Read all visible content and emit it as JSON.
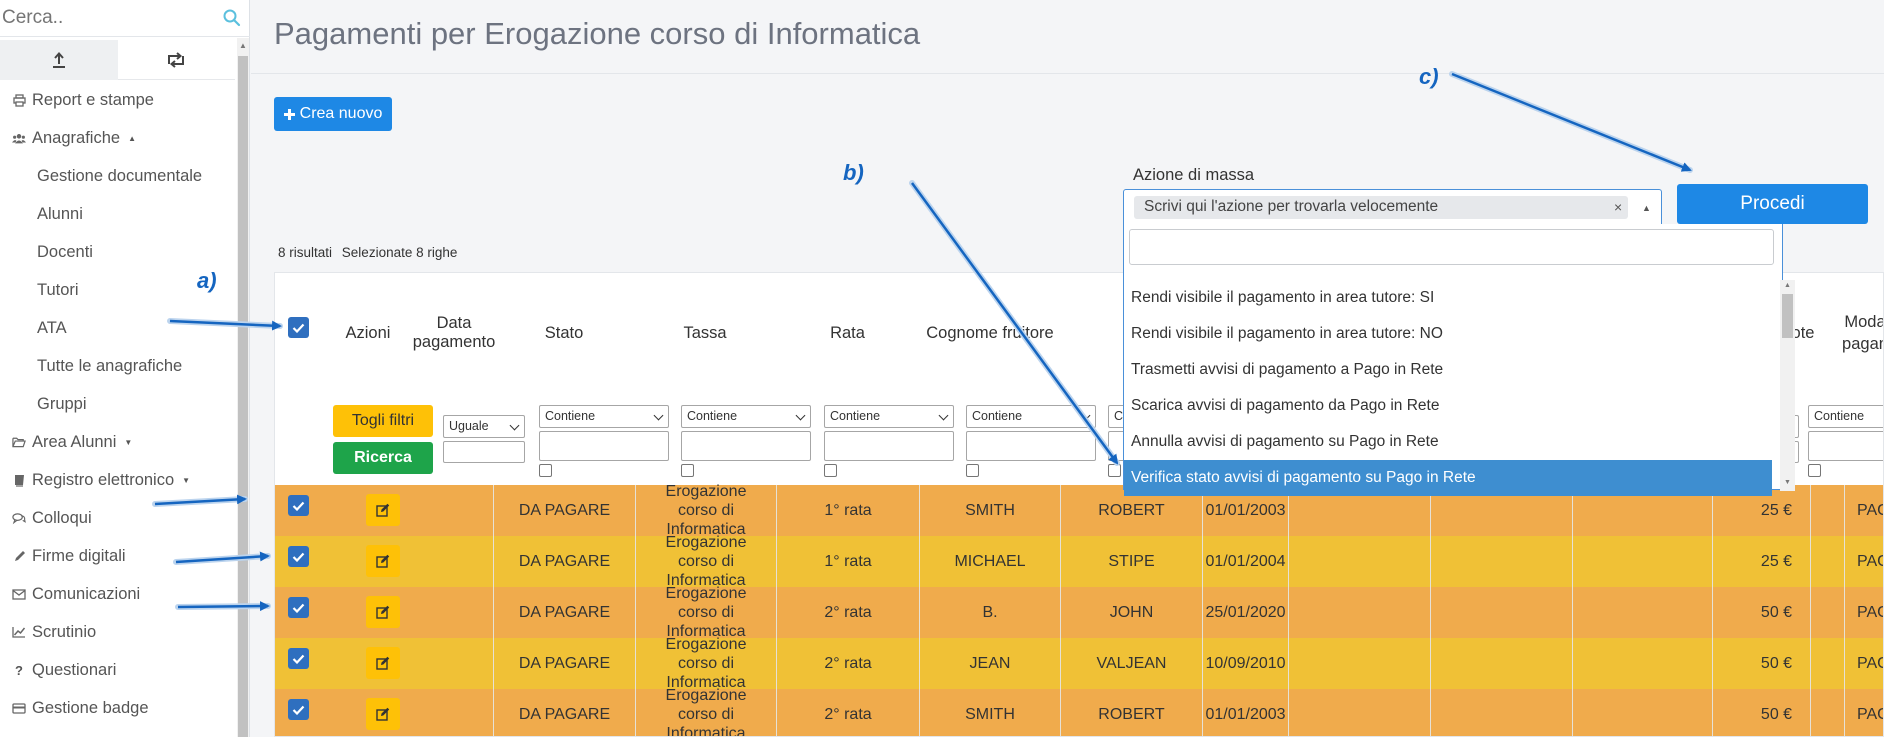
{
  "sidebar": {
    "search_placeholder": "Cerca..",
    "menu": [
      {
        "label": "Report e stampe",
        "icon": "print-icon",
        "level": 0
      },
      {
        "label": "Anagrafiche",
        "icon": "users-icon",
        "level": 0,
        "caret": "▲"
      },
      {
        "label": "Gestione documentale",
        "level": 1
      },
      {
        "label": "Alunni",
        "level": 1
      },
      {
        "label": "Docenti",
        "level": 1
      },
      {
        "label": "Tutori",
        "level": 1
      },
      {
        "label": "ATA",
        "level": 1
      },
      {
        "label": "Tutte le anagrafiche",
        "level": 1
      },
      {
        "label": "Gruppi",
        "level": 1
      },
      {
        "label": "Area Alunni",
        "icon": "folder-open-icon",
        "level": 0,
        "caret": "▼"
      },
      {
        "label": "Registro elettronico",
        "icon": "book-icon",
        "level": 0,
        "caret": "▼"
      },
      {
        "label": "Colloqui",
        "icon": "comments-icon",
        "level": 0
      },
      {
        "label": "Firme digitali",
        "icon": "pencil-icon",
        "level": 0
      },
      {
        "label": "Comunicazioni",
        "icon": "envelope-icon",
        "level": 0
      },
      {
        "label": "Scrutinio",
        "icon": "line-chart-icon",
        "level": 0
      },
      {
        "label": "Questionari",
        "icon": "question-icon",
        "level": 0
      },
      {
        "label": "Gestione badge",
        "icon": "credit-card-icon",
        "level": 0
      }
    ]
  },
  "page": {
    "title": "Pagamenti per Erogazione corso di Informatica",
    "create_button": "Crea nuovo",
    "mass_action_label": "Azione di massa",
    "mass_action_placeholder": "Scrivi qui l'azione per trovarla velocemente",
    "clear_symbol": "×",
    "procedi_button": "Procedi",
    "results_count": "8 risultati",
    "selected_count": "Selezionate 8 righe"
  },
  "dropdown": {
    "options": [
      "Rendi visibile il pagamento in area tutore: SI",
      "Rendi visibile il pagamento in area tutore: NO",
      "Trasmetti avvisi di pagamento a Pago in Rete",
      "Scarica avvisi di pagamento da Pago in Rete",
      "Annulla avvisi di pagamento su Pago in Rete",
      "Verifica stato avvisi di pagamento su Pago in Rete"
    ],
    "highlighted_index": 5
  },
  "table": {
    "headers": {
      "azioni": "Azioni",
      "data_pagamento": "Data pagamento",
      "stato": "Stato",
      "tassa": "Tassa",
      "rata": "Rata",
      "cognome": "Cognome fruitore",
      "note_partial": "ote",
      "modalita_partial": "Moda pagan"
    },
    "filters": {
      "togli_filtri": "Togli filtri",
      "ricerca": "Ricerca",
      "uguale": "Uguale",
      "contiene": "Contiene",
      "partial_c": "C"
    },
    "rows": [
      {
        "stato": "DA PAGARE",
        "tassa": "Erogazione corso di Informatica",
        "rata": "1° rata",
        "cognome": "SMITH",
        "nome": "ROBERT",
        "data": "01/01/2003",
        "importo": "25 €",
        "modalita": "PAGO"
      },
      {
        "stato": "DA PAGARE",
        "tassa": "Erogazione corso di Informatica",
        "rata": "1° rata",
        "cognome": "MICHAEL",
        "nome": "STIPE",
        "data": "01/01/2004",
        "importo": "25 €",
        "modalita": "PAGO"
      },
      {
        "stato": "DA PAGARE",
        "tassa": "Erogazione corso di Informatica",
        "rata": "2° rata",
        "cognome": "B.",
        "nome": "JOHN",
        "data": "25/01/2020",
        "importo": "50 €",
        "modalita": "PAGO"
      },
      {
        "stato": "DA PAGARE",
        "tassa": "Erogazione corso di Informatica",
        "rata": "2° rata",
        "cognome": "JEAN",
        "nome": "VALJEAN",
        "data": "10/09/2010",
        "importo": "50 €",
        "modalita": "PAGO"
      },
      {
        "stato": "DA PAGARE",
        "tassa": "Erogazione corso di Informatica",
        "rata": "2° rata",
        "cognome": "SMITH",
        "nome": "ROBERT",
        "data": "01/01/2003",
        "importo": "50 €",
        "modalita": "PAGO"
      }
    ]
  },
  "annotations": {
    "a": "a)",
    "b": "b)",
    "c": "c)"
  },
  "colors": {
    "primary": "#1e88e5",
    "row_orange": "#f0ab4c",
    "row_yellow": "#f0c136",
    "warning": "#fec107",
    "success": "#1ea44a",
    "highlight": "#3e8ed0",
    "annotation": "#1565c0"
  }
}
